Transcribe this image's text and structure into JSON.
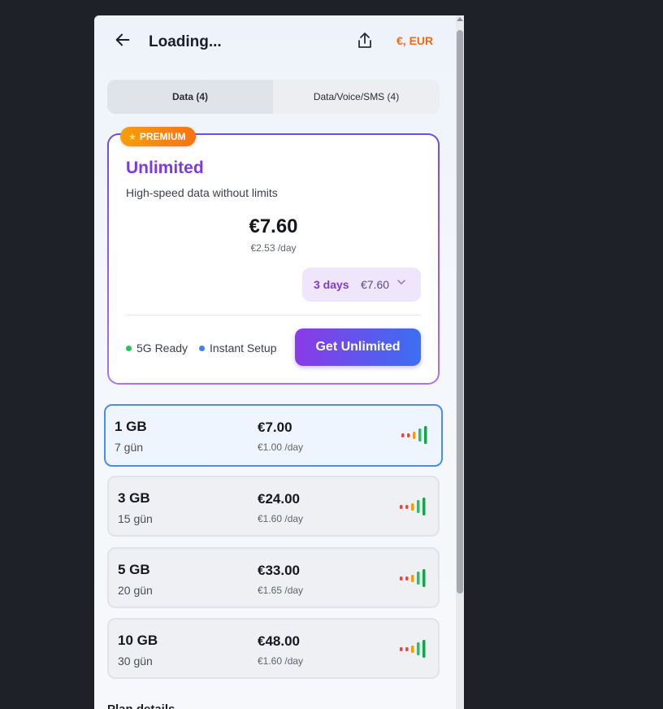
{
  "header": {
    "title": "Loading...",
    "currency": "€, EUR",
    "back_icon": "arrow-left-icon",
    "share_icon": "share-icon"
  },
  "tabs": [
    {
      "label": "Data (4)",
      "active": true
    },
    {
      "label": "Data/Voice/SMS (4)",
      "active": false
    }
  ],
  "premium": {
    "badge": "PREMIUM",
    "badge_icon": "star-icon",
    "name": "Unlimited",
    "description": "High-speed data without limits",
    "price": "€7.60",
    "per_day": "€2.53 /day",
    "selector": {
      "days": "3 days",
      "amount": "€7.60"
    },
    "features": [
      {
        "label": "5G Ready",
        "color": "#22c55e"
      },
      {
        "label": "Instant Setup",
        "color": "#3b82f6"
      }
    ],
    "cta": "Get Unlimited"
  },
  "plans": [
    {
      "size": "1 GB",
      "duration": "7 gün",
      "price": "€7.00",
      "per_day": "€1.00 /day",
      "selected": true
    },
    {
      "size": "3 GB",
      "duration": "15 gün",
      "price": "€24.00",
      "per_day": "€1.60 /day",
      "selected": false
    },
    {
      "size": "5 GB",
      "duration": "20 gün",
      "price": "€33.00",
      "per_day": "€1.65 /day",
      "selected": false
    },
    {
      "size": "10 GB",
      "duration": "30 gün",
      "price": "€48.00",
      "per_day": "€1.60 /day",
      "selected": false
    }
  ],
  "signal_colors": [
    "#ef4444",
    "#ef4444",
    "#f59e0b",
    "#22c55e",
    "#16a34a"
  ],
  "footer": {
    "label": "Plan details"
  },
  "colors": {
    "accent": "#7c3ae0",
    "currency": "#f26b14",
    "selected_border": "#4a8cf0"
  }
}
